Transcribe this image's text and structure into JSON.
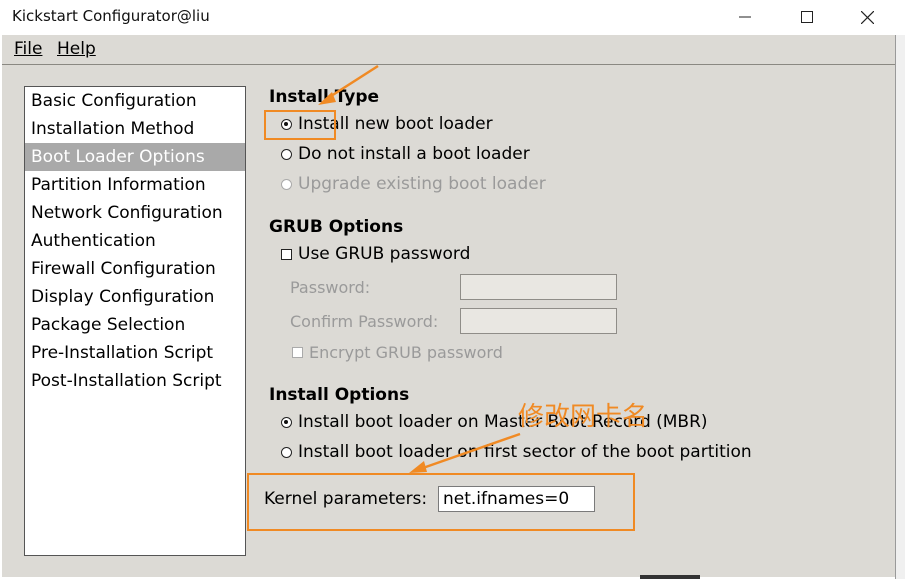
{
  "window": {
    "title": "Kickstart Configurator@liu",
    "controls": [
      "minimize-icon",
      "maximize-icon",
      "close-icon"
    ]
  },
  "menubar": {
    "file_label": "File",
    "help_label": "Help"
  },
  "sidebar": {
    "items": [
      {
        "label": "Basic Configuration",
        "selected": false
      },
      {
        "label": "Installation Method",
        "selected": false
      },
      {
        "label": "Boot Loader Options",
        "selected": true
      },
      {
        "label": "Partition Information",
        "selected": false
      },
      {
        "label": "Network Configuration",
        "selected": false
      },
      {
        "label": "Authentication",
        "selected": false
      },
      {
        "label": "Firewall Configuration",
        "selected": false
      },
      {
        "label": "Display Configuration",
        "selected": false
      },
      {
        "label": "Package Selection",
        "selected": false
      },
      {
        "label": "Pre-Installation Script",
        "selected": false
      },
      {
        "label": "Post-Installation Script",
        "selected": false
      }
    ]
  },
  "install_type": {
    "heading": "Install Type",
    "options": [
      {
        "label": "Install new boot loader",
        "selected": true,
        "enabled": true
      },
      {
        "label": "Do not install a boot loader",
        "selected": false,
        "enabled": true
      },
      {
        "label": "Upgrade existing boot loader",
        "selected": false,
        "enabled": false
      }
    ]
  },
  "grub_options": {
    "heading": "GRUB Options",
    "use_password_label": "Use GRUB password",
    "use_password_checked": false,
    "password_label": "Password:",
    "password_value": "",
    "confirm_label": "Confirm Password:",
    "confirm_value": "",
    "encrypt_label": "Encrypt GRUB password",
    "encrypt_checked": false
  },
  "install_options": {
    "heading": "Install Options",
    "options": [
      {
        "label": "Install boot loader on Master Boot Record (MBR)",
        "selected": true
      },
      {
        "label": "Install boot loader on first sector of the boot partition",
        "selected": false
      }
    ]
  },
  "kernel": {
    "label": "Kernel parameters:",
    "value": "net.ifnames=0"
  },
  "annotation": {
    "text": "修改网卡名",
    "color": "#f08a24"
  }
}
